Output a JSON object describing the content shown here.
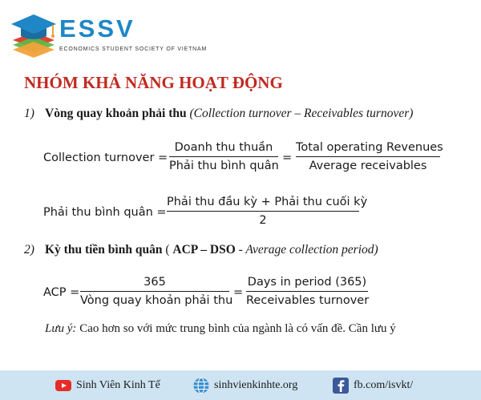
{
  "logo": {
    "wordmark": "ESSV",
    "subtitle": "ECONOMICS STUDENT SOCIETY OF VIETNAM",
    "colors": {
      "blue": "#1f87c6",
      "orange": "#f2a23a",
      "green": "#5fb648",
      "red": "#e0432f"
    }
  },
  "title": "NHÓM KHẢ NĂNG HOẠT ĐỘNG",
  "section1": {
    "number": "1)",
    "heading": "Vòng quay khoản phải thu",
    "heading_note": "(Collection turnover – Receivables turnover)",
    "eq1": {
      "lhs": "Collection turnover =",
      "num1": "Doanh thu thuần",
      "den1": "Phải thu bình quân",
      "eq_sign": "=",
      "num2": "Total operating Revenues",
      "den2": "Average receivables"
    },
    "eq2": {
      "lhs": "Phải thu bình quân =",
      "num": "Phải thu đầu kỳ + Phải thu cuối kỳ",
      "den": "2"
    }
  },
  "section2": {
    "number": "2)",
    "heading": "Kỳ thu tiền bình quân",
    "paren_open": " ( ",
    "acronym": "ACP – DSO",
    "tail": " - Average collection period)",
    "eq": {
      "lhs": "ACP =",
      "num1": "365",
      "den1": "Vòng quay khoản phải thu",
      "eq_sign": "=",
      "num2": "Days in period (365)",
      "den2": "Receivables turnover"
    }
  },
  "note": {
    "label": "Lưu ý:",
    "text": " Cao hơn so với mức trung bình của ngành là có vấn đề. Cần lưu ý"
  },
  "footer": {
    "background": "#cfe4f2",
    "items": [
      {
        "icon": "youtube-icon",
        "label": "Sinh Viên Kinh Tế"
      },
      {
        "icon": "globe-icon",
        "label": "sinhvienkinhte.org"
      },
      {
        "icon": "facebook-icon",
        "label": "fb.com/isvkt/"
      }
    ]
  }
}
